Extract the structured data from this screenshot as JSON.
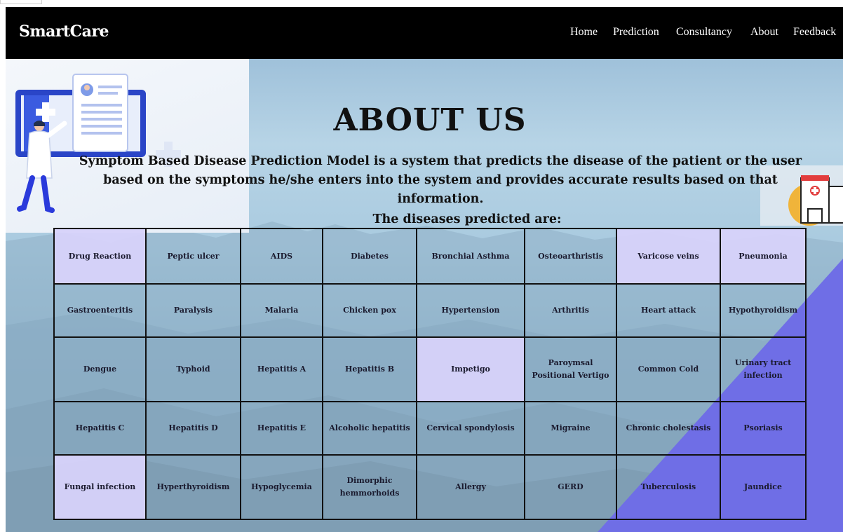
{
  "nav": {
    "brand": "SmartCare",
    "links": [
      "Home",
      "Prediction",
      "Consultancy",
      "About",
      "Feedback"
    ]
  },
  "about": {
    "title": "ABOUT US",
    "description": "Symptom Based Disease Prediction Model is a system that predicts the disease of the patient or the user based on the symptoms he/she enters into the system and provides accurate results based on that information.",
    "diseases_heading": "The diseases predicted are:"
  },
  "diseases": {
    "rows": [
      [
        "Drug Reaction",
        "Peptic ulcer",
        "AIDS",
        "Diabetes",
        "Bronchial Asthma",
        "Osteoarthristis",
        "Varicose veins",
        "Pneumonia"
      ],
      [
        "Gastroenteritis",
        "Paralysis",
        "Malaria",
        "Chicken pox",
        "Hypertension",
        "Arthritis",
        "Heart attack",
        "Hypothyroidism"
      ],
      [
        "Dengue",
        "Typhoid",
        "Hepatitis A",
        "Hepatitis B",
        "Impetigo",
        "Paroymsal Positional Vertigo",
        "Common Cold",
        "Urinary tract infection"
      ],
      [
        "Hepatitis C",
        "Hepatitis D",
        "Hepatitis E",
        "Alcoholic hepatitis",
        "Cervical spondylosis",
        "Migraine",
        "Chronic cholestasis",
        "Psoriasis"
      ],
      [
        "Fungal infection",
        "Hyperthyroidism",
        "Hypoglycemia",
        "Dimorphic hemmorhoids",
        "Allergy",
        "GERD",
        "Tuberculosis",
        "Jaundice"
      ]
    ]
  },
  "colors": {
    "nav_bg": "#000000",
    "highlight_cell": "#d7d2fa",
    "accent_triangle": "#6f6ee6"
  }
}
